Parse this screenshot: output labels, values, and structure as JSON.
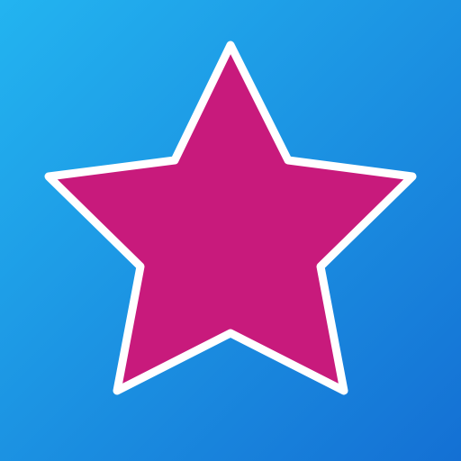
{
  "icon": {
    "name": "star-icon",
    "colors": {
      "background_top_left": "#23b4f0",
      "background_bottom_right": "#1470d4",
      "star_fill": "#c81a7c",
      "star_outline": "#ffffff"
    }
  }
}
